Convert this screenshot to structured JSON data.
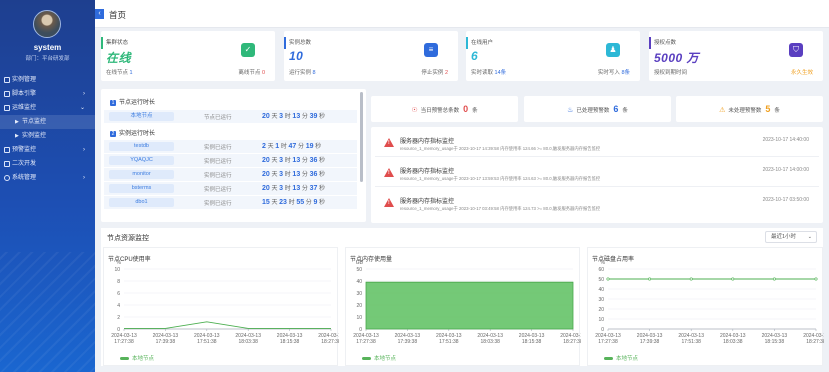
{
  "sidebar": {
    "user_name": "system",
    "user_dept": "部门：平台研发部",
    "items": [
      {
        "label": "实例管理",
        "icon": "grid-icon",
        "expandable": false
      },
      {
        "label": "脚本引擎",
        "icon": "script-icon",
        "expandable": true,
        "arrow": "›"
      },
      {
        "label": "运维监控",
        "icon": "monitor-icon",
        "expandable": true,
        "arrow": "⌄"
      },
      {
        "label": "节点监控",
        "icon": "",
        "sub": true
      },
      {
        "label": "实例监控",
        "icon": "",
        "sub": true
      },
      {
        "label": "预警监控",
        "icon": "alarm-icon",
        "expandable": true,
        "arrow": "›"
      },
      {
        "label": "二次开发",
        "icon": "code-icon",
        "expandable": false
      },
      {
        "label": "系统管理",
        "icon": "settings-icon",
        "expandable": true,
        "arrow": "›"
      }
    ]
  },
  "header": {
    "title": "首页",
    "collapse_icon": "‹"
  },
  "cards": [
    {
      "title": "集群状态",
      "value": "在线",
      "left_label": "在线节点",
      "left_value": "1",
      "right_label": "离线节点",
      "right_value": "0",
      "accent": "#2fb87a",
      "value_color": "#2fb87a",
      "icon_bg": "#2fb87a",
      "icon": "✓"
    },
    {
      "title": "实例总数",
      "value": "10",
      "left_label": "运行实例",
      "left_value": "8",
      "right_label": "停止实例",
      "right_value": "2",
      "accent": "#2f6bdc",
      "value_color": "#2f6bdc",
      "icon_bg": "#2f6bdc",
      "icon": "≡"
    },
    {
      "title": "在线用户",
      "value": "6",
      "left_label": "实时读取",
      "left_value": "14条",
      "right_label": "实时写入",
      "right_value": "8条",
      "accent": "#2db8d6",
      "value_color": "#2db8d6",
      "icon_bg": "#2db8d6",
      "icon": "♟"
    },
    {
      "title": "授权点数",
      "value": "5000 万",
      "left_label": "授权到期时间",
      "left_value": "",
      "right_label": "",
      "right_value": "永久生效",
      "accent": "#5a3fc0",
      "value_color": "#5a3fc0",
      "icon_bg": "#5a3fc0",
      "icon": "⛉"
    }
  ],
  "node_panel": {
    "section1_label": "节点运行时长",
    "section1_num": "1",
    "section2_label": "实例运行时长",
    "section2_num": "2",
    "local_node": {
      "name": "本地节点",
      "uptime_label": "节点已运行",
      "d": "20",
      "h": "3",
      "m": "13",
      "s": "39",
      "unit_d": "天",
      "unit_h": "时",
      "unit_m": "分",
      "unit_s": "秒"
    },
    "instances": [
      {
        "name": "testdb",
        "uptime_label": "实例已运行",
        "d": "2",
        "h": "1",
        "m": "47",
        "s": "19"
      },
      {
        "name": "YQAQJC",
        "uptime_label": "实例已运行",
        "d": "20",
        "h": "3",
        "m": "13",
        "s": "36"
      },
      {
        "name": "monitor",
        "uptime_label": "实例已运行",
        "d": "20",
        "h": "3",
        "m": "13",
        "s": "36"
      },
      {
        "name": "bsterms",
        "uptime_label": "实例已运行",
        "d": "20",
        "h": "3",
        "m": "13",
        "s": "37"
      },
      {
        "name": "dbo1",
        "uptime_label": "实例已运行",
        "d": "15",
        "h": "23",
        "m": "55",
        "s": "9"
      }
    ],
    "units": {
      "d": "天",
      "h": "时",
      "m": "分",
      "s": "秒"
    }
  },
  "alarm_counters": [
    {
      "label": "当日预警总条数",
      "value": "0",
      "unit": "条",
      "icon": "☉",
      "color": "#e04d4d"
    },
    {
      "label": "已处理预警数",
      "value": "6",
      "unit": "条",
      "icon": "♨",
      "color": "#2f6bdc"
    },
    {
      "label": "未处理预警数",
      "value": "5",
      "unit": "条",
      "icon": "⚠",
      "color": "#f0a020"
    }
  ],
  "alarms": [
    {
      "title": "服务器内存指标监控",
      "desc": "resource_1_memory_usage于 2023-10-17 14:39:58 内存使用率 124.66 >= 80.0,触发服务器内存报告监控",
      "time": "2023-10-17 14:40:00"
    },
    {
      "title": "服务器内存指标监控",
      "desc": "resource_1_memory_usage于 2023-10-17 13:59:53 内存使用率 124.63 >= 80.0,触发服务器内存报告监控",
      "time": "2023-10-17 14:00:00"
    },
    {
      "title": "服务器内存指标监控",
      "desc": "resource_1_memory_usage于 2023-10-17 03:49:58 内存使用率 124.73 >= 80.0,触发服务器内存报告监控",
      "time": "2023-10-17 03:50:00"
    }
  ],
  "resource": {
    "title": "节点资源监控",
    "range": "最近1小时",
    "legend": "本地节点"
  },
  "chart_data": [
    {
      "type": "line",
      "title": "节点CPU使用率",
      "ylabel": "%",
      "ylim": [
        0,
        10
      ],
      "yticks": [
        0,
        2,
        4,
        6,
        8,
        10
      ],
      "x": [
        "2024-03-13 17:27:38",
        "2024-03-13 17:39:38",
        "2024-03-13 17:51:38",
        "2024-03-13 18:03:38",
        "2024-03-13 18:15:38",
        "2024-03-13 18:27:38"
      ],
      "series": [
        {
          "name": "本地节点",
          "values": [
            0.1,
            0.1,
            1.2,
            0.1,
            0.1,
            0.1
          ]
        }
      ]
    },
    {
      "type": "area",
      "title": "节点内存使用量",
      "ylabel": "GB",
      "ylim": [
        0,
        50
      ],
      "yticks": [
        0,
        10,
        20,
        30,
        40,
        50
      ],
      "x": [
        "2024-03-13 17:27:38",
        "2024-03-13 17:39:38",
        "2024-03-13 17:51:38",
        "2024-03-13 18:03:38",
        "2024-03-13 18:15:38",
        "2024-03-13 18:27:38"
      ],
      "series": [
        {
          "name": "本地节点",
          "values": [
            39,
            39,
            39,
            39,
            39,
            39
          ]
        }
      ]
    },
    {
      "type": "line",
      "title": "节点磁盘占用率",
      "ylabel": "%",
      "ylim": [
        0,
        60
      ],
      "yticks": [
        0,
        10,
        20,
        30,
        40,
        50,
        60
      ],
      "x": [
        "2024-03-13 17:27:38",
        "2024-03-13 17:39:38",
        "2024-03-13 17:51:38",
        "2024-03-13 18:03:38",
        "2024-03-13 18:15:38",
        "2024-03-13 18:27:38"
      ],
      "series": [
        {
          "name": "本地节点",
          "values": [
            50,
            50,
            50,
            50,
            50,
            50
          ]
        }
      ]
    }
  ]
}
